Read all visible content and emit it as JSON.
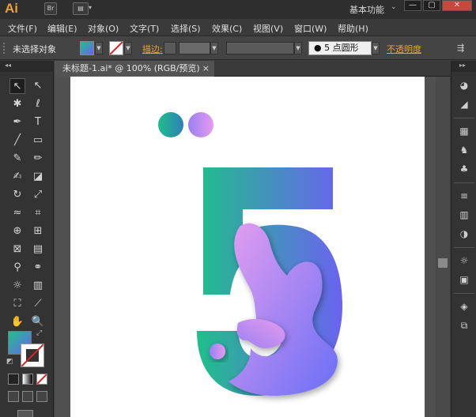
{
  "app": {
    "logo": "Ai",
    "bridge_label": "Br",
    "workspace_label": "基本功能",
    "window_controls": [
      "—",
      "▢",
      "✕"
    ]
  },
  "menus": [
    "文件(F)",
    "编辑(E)",
    "对象(O)",
    "文字(T)",
    "选择(S)",
    "效果(C)",
    "视图(V)",
    "窗口(W)",
    "帮助(H)"
  ],
  "control_bar": {
    "selection_status": "未选择对象",
    "stroke_label": "描边:",
    "brush_label": "5 点圆形",
    "opacity_label": "不透明度",
    "accent_color": "#e8a13a"
  },
  "document": {
    "tab_label": "未标题-1.ai* @ 100% (RGB/预览)",
    "close_glyph": "×"
  },
  "tools": [
    {
      "name": "selection-tool-icon",
      "glyph": "↖"
    },
    {
      "name": "direct-selection-tool-icon",
      "glyph": "↖"
    },
    {
      "name": "magic-wand-tool-icon",
      "glyph": "✱"
    },
    {
      "name": "lasso-tool-icon",
      "glyph": "ℓ"
    },
    {
      "name": "pen-tool-icon",
      "glyph": "✒"
    },
    {
      "name": "type-tool-icon",
      "glyph": "T"
    },
    {
      "name": "line-tool-icon",
      "glyph": "╱"
    },
    {
      "name": "rectangle-tool-icon",
      "glyph": "▭"
    },
    {
      "name": "paintbrush-tool-icon",
      "glyph": "✎"
    },
    {
      "name": "pencil-tool-icon",
      "glyph": "✏"
    },
    {
      "name": "blob-brush-tool-icon",
      "glyph": "✍"
    },
    {
      "name": "eraser-tool-icon",
      "glyph": "◪"
    },
    {
      "name": "rotate-tool-icon",
      "glyph": "↻"
    },
    {
      "name": "scale-tool-icon",
      "glyph": "⤢"
    },
    {
      "name": "width-tool-icon",
      "glyph": "≈"
    },
    {
      "name": "free-transform-tool-icon",
      "glyph": "⌗"
    },
    {
      "name": "shape-builder-tool-icon",
      "glyph": "⊕"
    },
    {
      "name": "perspective-grid-tool-icon",
      "glyph": "⊞"
    },
    {
      "name": "mesh-tool-icon",
      "glyph": "⊠"
    },
    {
      "name": "gradient-tool-icon",
      "glyph": "▤"
    },
    {
      "name": "eyedropper-tool-icon",
      "glyph": "⚲"
    },
    {
      "name": "blend-tool-icon",
      "glyph": "⚭"
    },
    {
      "name": "symbol-sprayer-tool-icon",
      "glyph": "☼"
    },
    {
      "name": "column-graph-tool-icon",
      "glyph": "▥"
    },
    {
      "name": "artboard-tool-icon",
      "glyph": "⛶"
    },
    {
      "name": "slice-tool-icon",
      "glyph": "⟋"
    },
    {
      "name": "hand-tool-icon",
      "glyph": "✋"
    },
    {
      "name": "zoom-tool-icon",
      "glyph": "🔍"
    }
  ],
  "right_panel_icons": [
    {
      "name": "color-icon",
      "glyph": "◕"
    },
    {
      "name": "color-guide-icon",
      "glyph": "◢"
    },
    {
      "name": "swatches-icon",
      "glyph": "▦"
    },
    {
      "name": "brushes-icon",
      "glyph": "♞"
    },
    {
      "name": "symbols-icon",
      "glyph": "♣"
    },
    {
      "name": "stroke-icon",
      "glyph": "≡"
    },
    {
      "name": "gradient-icon",
      "glyph": "▥"
    },
    {
      "name": "transparency-icon",
      "glyph": "◑"
    },
    {
      "name": "appearance-icon",
      "glyph": "☼"
    },
    {
      "name": "graphic-styles-icon",
      "glyph": "▣"
    },
    {
      "name": "layers-icon",
      "glyph": "◈"
    },
    {
      "name": "artboards-icon",
      "glyph": "⧉"
    }
  ],
  "artwork": {
    "gradient_start": "#1fbf8a",
    "gradient_end": "#6b63f0",
    "blob_start": "#e39ef0",
    "blob_end": "#6a6ef5",
    "dot_left_start": "#1fbf8a",
    "dot_left_end": "#2f7fb8",
    "dot_right_start": "#9a80f0",
    "dot_right_end": "#e59bf0"
  }
}
